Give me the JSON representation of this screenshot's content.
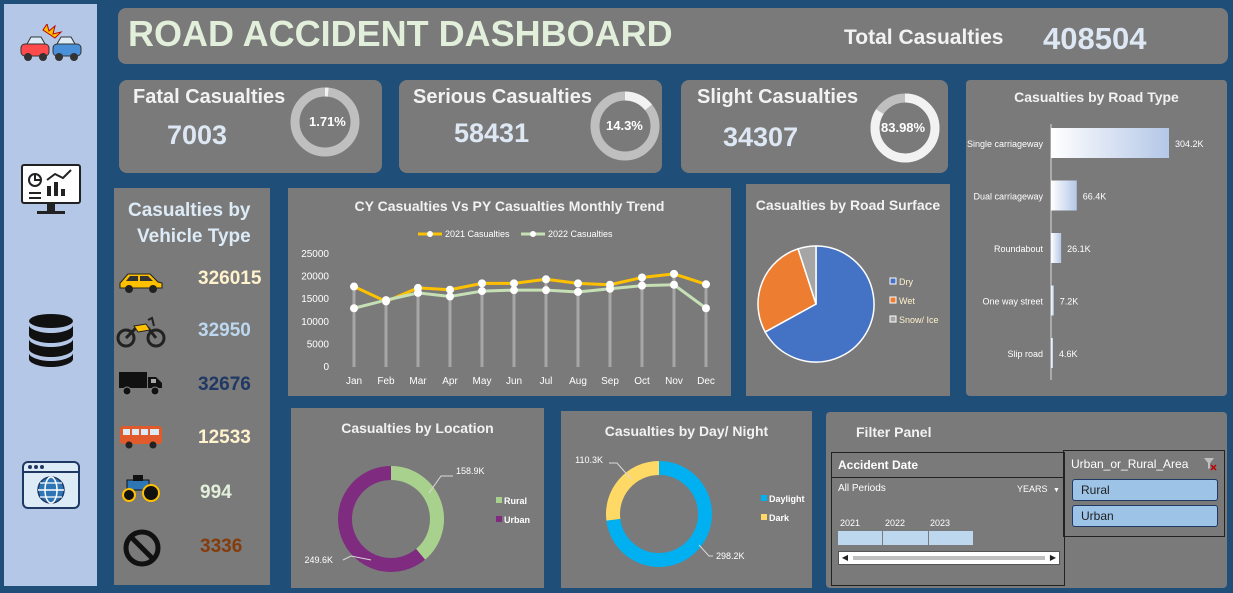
{
  "header": {
    "title": "ROAD ACCIDENT DASHBOARD",
    "total_label": "Total Casualties",
    "total_value": "408504"
  },
  "kpis": [
    {
      "label": "Fatal Casualties",
      "value": "7003",
      "pct_label": "1.71%",
      "pct": 0.0171
    },
    {
      "label": "Serious Casualties",
      "value": "58431",
      "pct_label": "14.3%",
      "pct": 0.143
    },
    {
      "label": "Slight Casualties",
      "value": "34307",
      "pct_label": "83.98%",
      "pct": 0.8398
    }
  ],
  "vehicle": {
    "title1": "Casualties by",
    "title2": "Vehicle Type",
    "items": [
      {
        "icon": "car-icon",
        "value": "326015",
        "color": "#fff2cc"
      },
      {
        "icon": "motorcycle-icon",
        "value": "32950",
        "color": "#bdd7ee"
      },
      {
        "icon": "truck-icon",
        "value": "32676",
        "color": "#1f3864"
      },
      {
        "icon": "bus-icon",
        "value": "12533",
        "color": "#fff2cc"
      },
      {
        "icon": "tractor-icon",
        "value": "994",
        "color": "#e2efda"
      },
      {
        "icon": "no-entry-icon",
        "value": "3336",
        "color": "#843c0c"
      }
    ]
  },
  "sidebar": {
    "icons": [
      "car-crash-icon",
      "dashboard-monitor-icon",
      "database-icon",
      "web-globe-icon"
    ]
  },
  "trend": {
    "title": "CY Casualties Vs PY Casualties Monthly Trend",
    "chart_data": {
      "type": "line",
      "categories": [
        "Jan",
        "Feb",
        "Mar",
        "Apr",
        "May",
        "Jun",
        "Jul",
        "Aug",
        "Sep",
        "Oct",
        "Nov",
        "Dec"
      ],
      "series": [
        {
          "name": "2021 Casualties",
          "color": "#ffc000",
          "values": [
            17800,
            14500,
            17500,
            17100,
            18500,
            18500,
            19400,
            18500,
            18200,
            19800,
            20600,
            18300
          ]
        },
        {
          "name": "2022 Casualties",
          "color": "#c5e0b4",
          "values": [
            13000,
            14800,
            16400,
            15600,
            16800,
            17000,
            17000,
            16600,
            17300,
            18000,
            18200,
            13000
          ]
        }
      ],
      "yticks": [
        "0",
        "5000",
        "10000",
        "15000",
        "20000",
        "25000"
      ],
      "ylim": [
        0,
        25000
      ],
      "legend": "top"
    }
  },
  "surface": {
    "title": "Casualties by Road Surface",
    "chart_data": {
      "type": "pie",
      "categories": [
        "Dry",
        "Wet",
        "Snow/ Ice"
      ],
      "values": [
        67,
        28,
        5
      ],
      "colors": [
        "#4472c4",
        "#ed7d31",
        "#a5a5a5"
      ],
      "legend": "right"
    }
  },
  "roadtype": {
    "title": "Casualties by Road Type",
    "chart_data": {
      "type": "bar",
      "orientation": "horizontal",
      "categories": [
        "Single carriageway",
        "Dual carriageway",
        "Roundabout",
        "One way street",
        "Slip road"
      ],
      "values": [
        304.2,
        66.4,
        26.1,
        7.2,
        4.6
      ],
      "labels": [
        "304.2K",
        "66.4K",
        "26.1K",
        "7.2K",
        "4.6K"
      ],
      "unit": "K"
    }
  },
  "location": {
    "title": "Casualties by Location",
    "chart_data": {
      "type": "pie",
      "style": "donut",
      "categories": [
        "Rural",
        "Urban"
      ],
      "values": [
        158.9,
        249.6
      ],
      "labels": [
        "158.9K",
        "249.6K"
      ],
      "colors": [
        "#a9d18e",
        "#7f2b7f"
      ],
      "legend": "right"
    }
  },
  "daynight": {
    "title": "Casualties by Day/ Night",
    "chart_data": {
      "type": "pie",
      "style": "donut",
      "categories": [
        "Daylight",
        "Dark"
      ],
      "values": [
        298.2,
        110.3
      ],
      "labels": [
        "298.2K",
        "110.3K"
      ],
      "colors": [
        "#00b0f0",
        "#ffd966"
      ],
      "legend": "right"
    }
  },
  "filter": {
    "title": "Filter Panel",
    "timeline": {
      "header": "Accident  Date",
      "periods": "All Periods",
      "level": "YEARS",
      "years": [
        "2021",
        "2022",
        "2023"
      ]
    },
    "slicer": {
      "header": "Urban_or_Rural_Area",
      "options": [
        "Rural",
        "Urban"
      ]
    }
  }
}
